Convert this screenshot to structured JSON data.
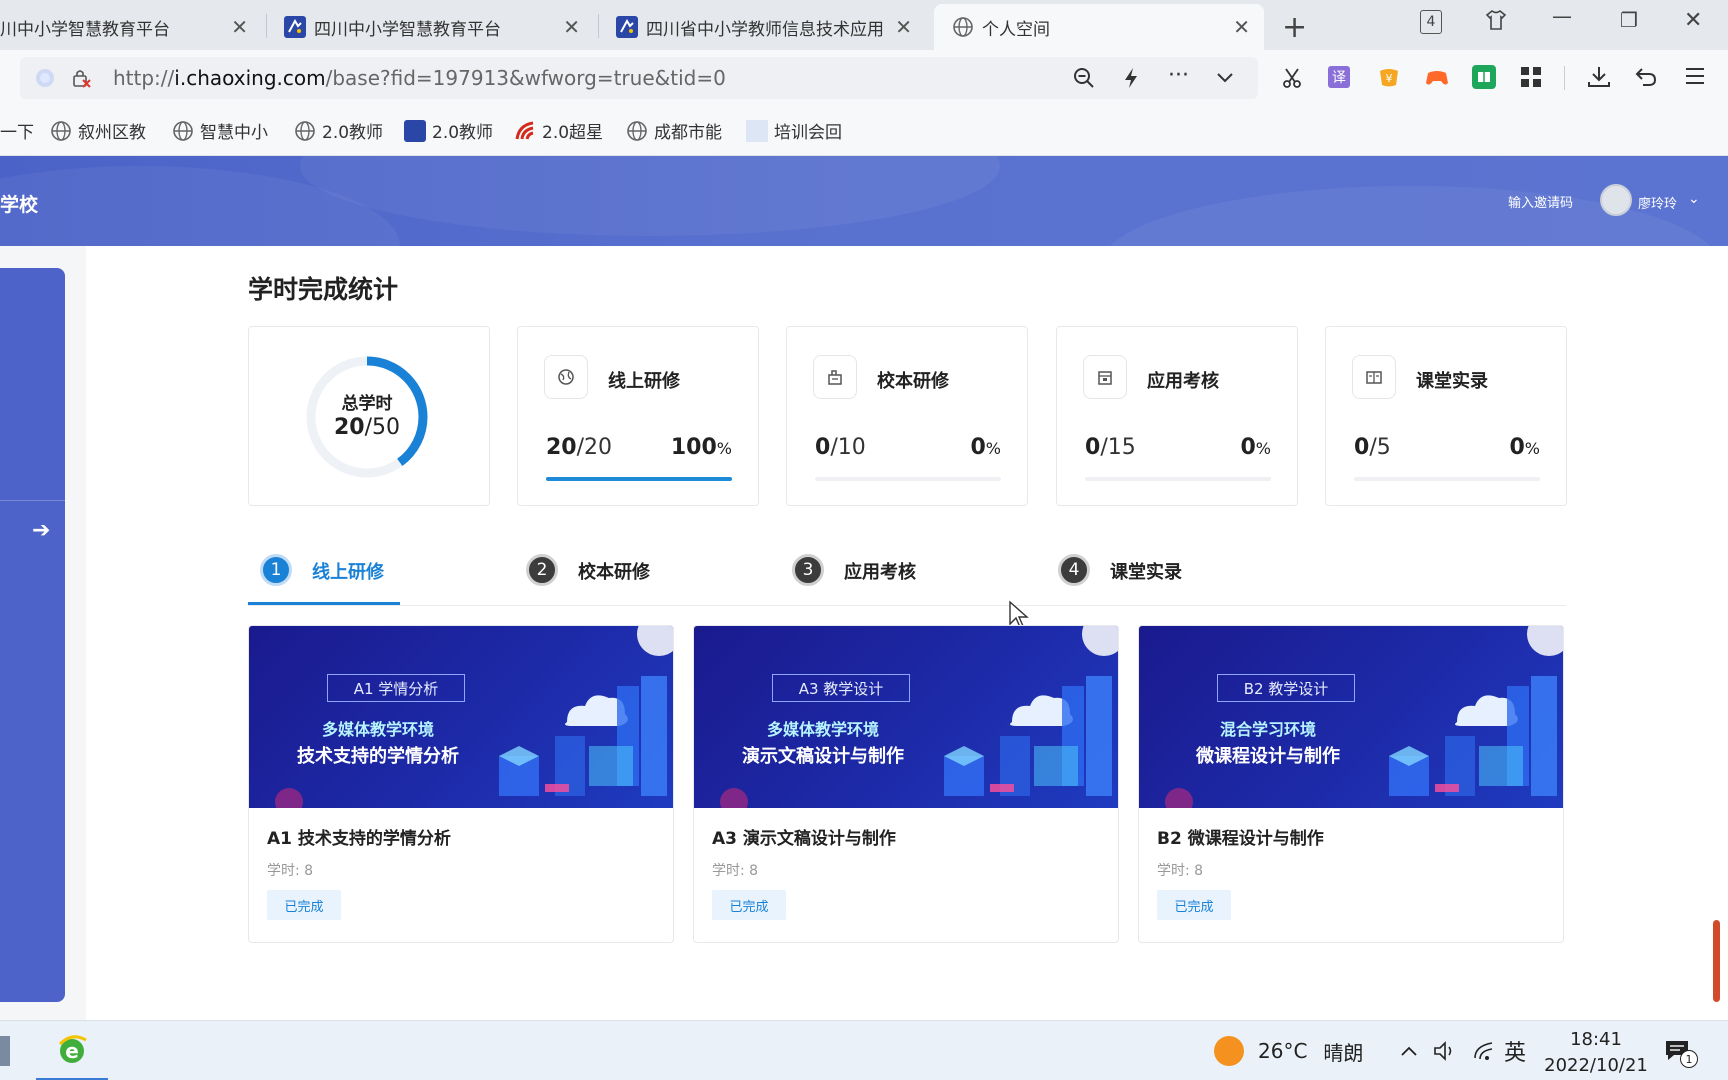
{
  "browser": {
    "tabs": [
      {
        "title": "川中小学智慧教育平台"
      },
      {
        "title": "四川中小学智慧教育平台"
      },
      {
        "title": "四川省中小学教师信息技术应用"
      },
      {
        "title": "个人空间"
      }
    ],
    "tab_count_badge": "4",
    "url_prefix": "http://",
    "url_host": "i.chaoxing.com",
    "url_path": "/base?fid=197913&wfworg=true&tid=0",
    "bookmarks": [
      {
        "label": "一下"
      },
      {
        "label": "叙州区教"
      },
      {
        "label": "智慧中小"
      },
      {
        "label": "2.0教师"
      },
      {
        "label": "2.0教师"
      },
      {
        "label": "2.0超星"
      },
      {
        "label": "成都市能"
      },
      {
        "label": "培训会回"
      }
    ]
  },
  "header": {
    "site_name": "学校",
    "invite_code": "输入邀请码",
    "user_name": "廖玲玲"
  },
  "stats": {
    "section_title": "学时完成统计",
    "total": {
      "title": "总学时",
      "done": "20",
      "total": "/50",
      "fraction": 0.4
    },
    "cards": [
      {
        "label": "线上研修",
        "done": "20",
        "total": "/20",
        "pct": "100",
        "pct_unit": "%",
        "fraction": 1.0
      },
      {
        "label": "校本研修",
        "done": "0",
        "total": "/10",
        "pct": "0",
        "pct_unit": "%",
        "fraction": 0
      },
      {
        "label": "应用考核",
        "done": "0",
        "total": "/15",
        "pct": "0",
        "pct_unit": "%",
        "fraction": 0
      },
      {
        "label": "课堂实录",
        "done": "0",
        "total": "/5",
        "pct": "0",
        "pct_unit": "%",
        "fraction": 0
      }
    ]
  },
  "steps": [
    {
      "num": "1",
      "label": "线上研修",
      "active": true
    },
    {
      "num": "2",
      "label": "校本研修"
    },
    {
      "num": "3",
      "label": "应用考核"
    },
    {
      "num": "4",
      "label": "课堂实录"
    }
  ],
  "courses": [
    {
      "tag": "A1 学情分析",
      "line1": "多媒体教学环境",
      "line2": "技术支持的学情分析",
      "title": "A1 技术支持的学情分析",
      "hours": "学时: 8",
      "status": "已完成"
    },
    {
      "tag": "A3 教学设计",
      "line1": "多媒体教学环境",
      "line2": "演示文稿设计与制作",
      "title": "A3 演示文稿设计与制作",
      "hours": "学时: 8",
      "status": "已完成"
    },
    {
      "tag": "B2 教学设计",
      "line1": "混合学习环境",
      "line2": "微课程设计与制作",
      "title": "B2 微课程设计与制作",
      "hours": "学时: 8",
      "status": "已完成"
    }
  ],
  "taskbar": {
    "temperature": "26°C",
    "weather": "晴朗",
    "ime": "英",
    "time": "18:41",
    "date": "2022/10/21",
    "notifications": "1"
  },
  "colors": {
    "accent": "#1a82d6",
    "header_bg": "#5a72cf",
    "sidebar_bg": "#4e63c9",
    "banner_bg": "#1d2aa8"
  }
}
